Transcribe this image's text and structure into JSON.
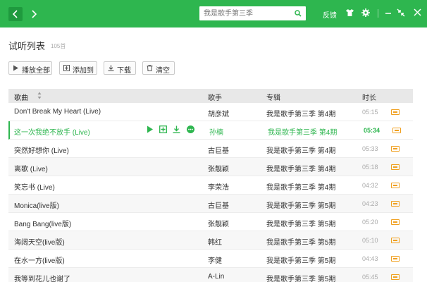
{
  "header": {
    "search_placeholder": "我是歌手第三季",
    "feedback_label": "反馈"
  },
  "page": {
    "title": "试听列表",
    "count": "105首"
  },
  "toolbar": {
    "play_all": "播放全部",
    "add_to": "添加到",
    "download": "下载",
    "clear": "清空"
  },
  "table": {
    "columns": {
      "title": "歌曲",
      "artist": "歌手",
      "album": "专辑",
      "duration": "时长"
    },
    "rows": [
      {
        "title": "Don't Break My Heart (Live)",
        "artist": "胡彦斌",
        "album": "我是歌手第三季 第4期",
        "duration": "05:15"
      },
      {
        "title": "这一次我绝不放手 (Live)",
        "artist": "孙楠",
        "album": "我是歌手第三季 第4期",
        "duration": "05:34"
      },
      {
        "title": "突然好想你 (Live)",
        "artist": "古巨基",
        "album": "我是歌手第三季 第4期",
        "duration": "05:33"
      },
      {
        "title": "离歌 (Live)",
        "artist": "张靓颖",
        "album": "我是歌手第三季 第4期",
        "duration": "05:18"
      },
      {
        "title": "笑忘书 (Live)",
        "artist": "李荣浩",
        "album": "我是歌手第三季 第4期",
        "duration": "04:32"
      },
      {
        "title": "Monica(live版)",
        "artist": "古巨基",
        "album": "我是歌手第三季 第5期",
        "duration": "04:23"
      },
      {
        "title": "Bang Bang(live版)",
        "artist": "张靓颖",
        "album": "我是歌手第三季 第5期",
        "duration": "05:20"
      },
      {
        "title": "海阔天空(live版)",
        "artist": "韩红",
        "album": "我是歌手第三季 第5期",
        "duration": "05:10"
      },
      {
        "title": "在水一方(live版)",
        "artist": "李健",
        "album": "我是歌手第三季 第5期",
        "duration": "04:43"
      },
      {
        "title": "我等到花儿也谢了",
        "artist": "A-Lin",
        "album": "我是歌手第三季 第5期",
        "duration": "05:45"
      }
    ]
  },
  "colors": {
    "accent": "#2eb64f",
    "badge": "#f0a020"
  }
}
